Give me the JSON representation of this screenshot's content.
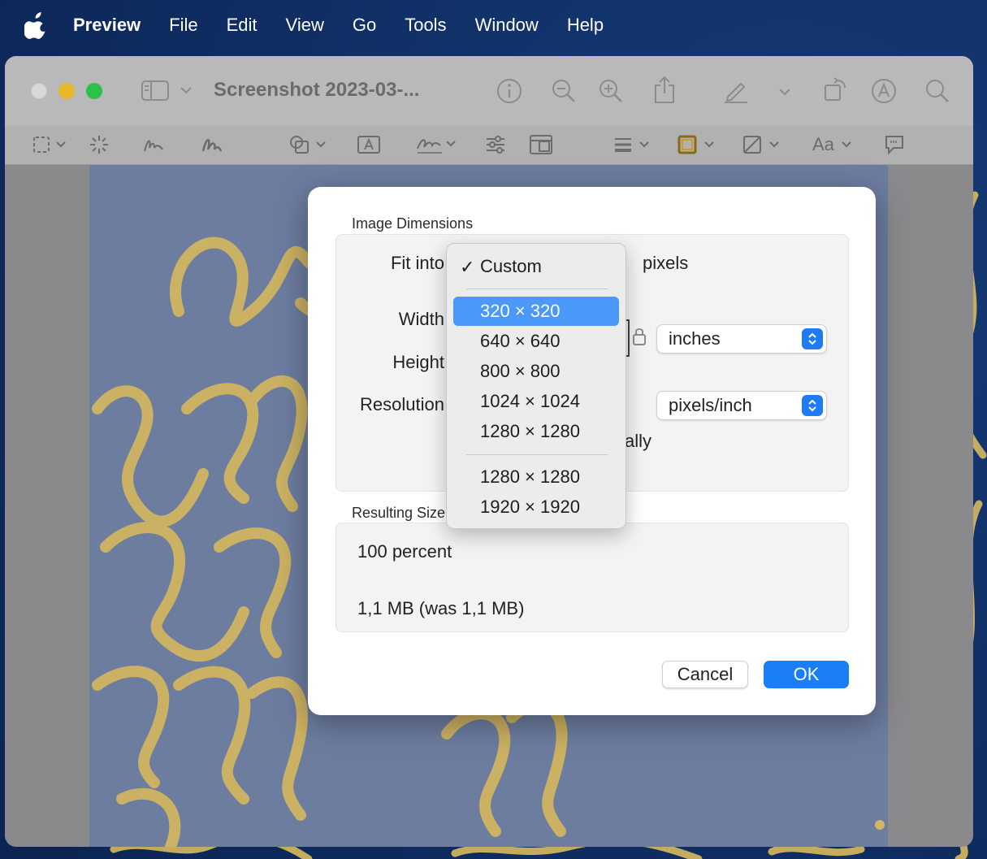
{
  "menubar": {
    "app_name": "Preview",
    "items": [
      "File",
      "Edit",
      "View",
      "Go",
      "Tools",
      "Window",
      "Help"
    ]
  },
  "window": {
    "title": "Screenshot 2023-03-...",
    "toolbar_icons": [
      "sidebar-icon",
      "info-icon",
      "zoom-out-icon",
      "zoom-in-icon",
      "share-icon",
      "markup-icon",
      "rotate-icon",
      "annotate-icon",
      "search-icon"
    ],
    "markup_tools": [
      "rect-select-icon",
      "instant-alpha-icon",
      "sketch-icon",
      "draw-icon",
      "shapes-icon",
      "text-box-icon",
      "sign-icon",
      "adjust-color-icon",
      "adjust-size-icon",
      "line-style-icon",
      "border-color-icon",
      "fill-color-icon",
      "text-style-icon",
      "speech-bubble-icon"
    ],
    "text_style_label": "Aa"
  },
  "dialog": {
    "image_dimensions_label": "Image Dimensions",
    "fit_into_label": "Fit into",
    "fit_into_unit": "pixels",
    "width_label": "Width",
    "height_label": "Height",
    "resolution_label": "Resolution",
    "size_unit": "inches",
    "resolution_unit": "pixels/inch",
    "scale_suffix": "ally",
    "resulting_size_label": "Resulting Size",
    "percent_text": "100 percent",
    "file_size_text": "1,1 MB (was 1,1 MB)",
    "cancel_label": "Cancel",
    "ok_label": "OK"
  },
  "dropdown": {
    "checked_item": "Custom",
    "group1": [
      "320 × 320",
      "640 × 640",
      "800 × 800",
      "1024 × 1024",
      "1280 × 1280"
    ],
    "group2": [
      "1280 × 1280",
      "1920 × 1920"
    ],
    "highlighted_item": "320 × 320"
  },
  "colors": {
    "accent": "#1a7ef5",
    "highlight": "#4a98f7",
    "wallpaper": "#0f2d62",
    "lettering_gold": "#d9b95e"
  }
}
